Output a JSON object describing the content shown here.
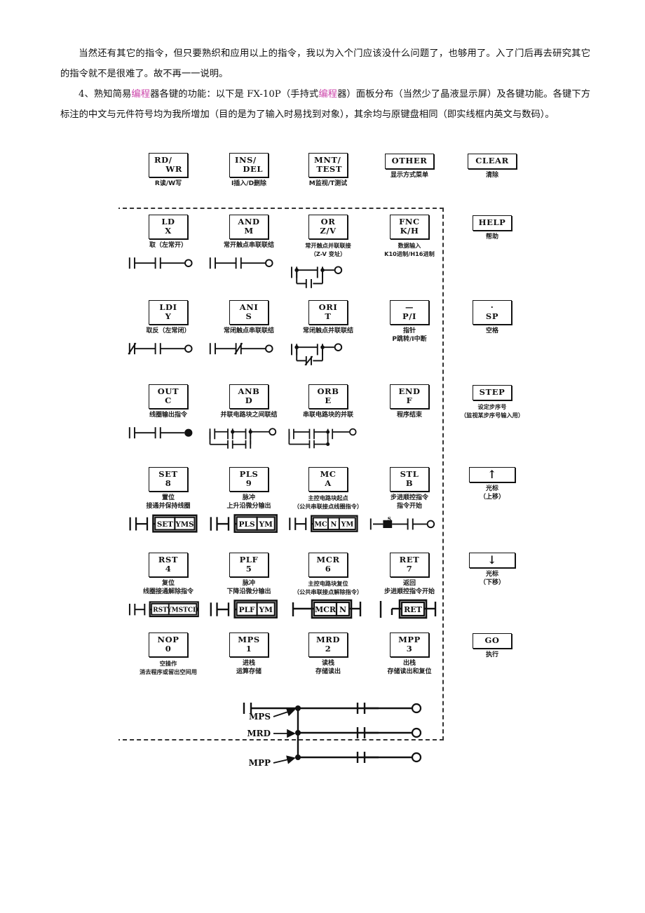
{
  "prose": {
    "p1_a": "当然还有其它的指令，但只要熟织和应用以上的指令，我以为入个门应该没什么问题了，也够用了。入了门后再去研究其它的指令就不是很难了。故不再一一说明。",
    "p2_a": "4、熟知简易",
    "p2_hl1": "编程",
    "p2_b": "器各键的功能：以下是 FX-10P（手持式",
    "p2_hl2": "编程",
    "p2_c": "器）面板分布（当然少了晶液显示屏）及各键功能。各键下方标注的中文与元件符号均为我所增加（目的是为了输入时易找到对象），其余均与原键盘相同（即实线框内英文与数码）。",
    "highlight_color": "#cc44aa"
  },
  "keypad": {
    "keys": [
      {
        "id": "rd-wr",
        "l1": "RD/",
        "l2": "WR",
        "zh": [
          "R读/W写"
        ]
      },
      {
        "id": "ins-del",
        "l1": "INS/",
        "l2": "DEL",
        "zh": [
          "I插入/D删除"
        ]
      },
      {
        "id": "mnt-test",
        "l1": "MNT/",
        "l2": "TEST",
        "zh": [
          "M监视/T测试"
        ]
      },
      {
        "id": "other",
        "l1": "OTHER",
        "l2": "",
        "zh": [
          "显示方式菜单"
        ]
      },
      {
        "id": "clear",
        "l1": "CLEAR",
        "l2": "",
        "zh": [
          "清除"
        ]
      },
      {
        "id": "ld-x",
        "l1": "LD",
        "l2": "X",
        "zh": [
          "取（左常开）"
        ],
        "ladder": "no-contact"
      },
      {
        "id": "and-m",
        "l1": "AND",
        "l2": "M",
        "zh": [
          "常开触点串联联结"
        ],
        "ladder": "and-series"
      },
      {
        "id": "or-zv",
        "l1": "OR",
        "l2": "Z/V",
        "zh": [
          "常开触点并联联接",
          "（Z-V 变址）"
        ],
        "ladder": "or-parallel"
      },
      {
        "id": "fnc-kh",
        "l1": "FNC",
        "l2": "K/H",
        "zh": [
          "数据输入",
          "K10进制/H16进制"
        ]
      },
      {
        "id": "help",
        "l1": "HELP",
        "l2": "",
        "zh": [
          "帮助"
        ]
      },
      {
        "id": "ldi-y",
        "l1": "LDI",
        "l2": "Y",
        "zh": [
          "取反（左常闭）"
        ],
        "ladder": "nc-contact"
      },
      {
        "id": "ani-s",
        "l1": "ANI",
        "l2": "S",
        "zh": [
          "常闭触点串联联结"
        ],
        "ladder": "ani-series"
      },
      {
        "id": "ori-t",
        "l1": "ORI",
        "l2": "T",
        "zh": [
          "常闭触点并联联结"
        ],
        "ladder": "ori-parallel"
      },
      {
        "id": "p-i",
        "l1": "—",
        "l2": "P/I",
        "zh": [
          "指针",
          "P跳转/I中断"
        ]
      },
      {
        "id": "sp",
        "l1": "·",
        "l2": "SP",
        "zh": [
          "空格"
        ]
      },
      {
        "id": "out-c",
        "l1": "OUT",
        "l2": "C",
        "zh": [
          "线圈输出指令"
        ],
        "ladder": "out-coil"
      },
      {
        "id": "anb-d",
        "l1": "ANB",
        "l2": "D",
        "zh": [
          "并联电路块之间联结"
        ],
        "ladder": "anb"
      },
      {
        "id": "orb-e",
        "l1": "ORB",
        "l2": "E",
        "zh": [
          "串联电路块的并联"
        ],
        "ladder": "orb"
      },
      {
        "id": "end-f",
        "l1": "END",
        "l2": "F",
        "zh": [
          "程序结束"
        ]
      },
      {
        "id": "step",
        "l1": "STEP",
        "l2": "",
        "zh": [
          "设定步序号",
          "（监视某步序号输入用）"
        ]
      },
      {
        "id": "set-8",
        "l1": "SET",
        "l2": "8",
        "zh": [
          "置位",
          "接通并保持线圈"
        ],
        "ladder": "box",
        "box": [
          "SET",
          "YMS"
        ]
      },
      {
        "id": "pls-9",
        "l1": "PLS",
        "l2": "9",
        "zh": [
          "脉冲",
          "上升沿微分输出"
        ],
        "ladder": "box",
        "box": [
          "PLS",
          "YM"
        ]
      },
      {
        "id": "mc-a",
        "l1": "MC",
        "l2": "A",
        "zh": [
          "主控电路块起点",
          "（公共串联接点线圈指令）"
        ],
        "ladder": "box3",
        "box": [
          "MC",
          "N",
          "YM"
        ]
      },
      {
        "id": "stl-b",
        "l1": "STL",
        "l2": "B",
        "zh": [
          "步进顺控指令",
          "指令开始"
        ],
        "ladder": "stl"
      },
      {
        "id": "cursor-up",
        "l1": "↑",
        "l2": "",
        "zh": [
          "光标",
          "（上移）"
        ]
      },
      {
        "id": "rst-4",
        "l1": "RST",
        "l2": "4",
        "zh": [
          "复位",
          "线圈接通解除指令"
        ],
        "ladder": "box",
        "box": [
          "RST",
          "YMSTCD"
        ]
      },
      {
        "id": "plf-5",
        "l1": "PLF",
        "l2": "5",
        "zh": [
          "脉冲",
          "下降沿微分输出"
        ],
        "ladder": "box",
        "box": [
          "PLF",
          "YM"
        ]
      },
      {
        "id": "mcr-6",
        "l1": "MCR",
        "l2": "6",
        "zh": [
          "主控电路块复位",
          "（公共串联接点解除指令）"
        ],
        "ladder": "boxmcr",
        "box": [
          "MCR",
          "N"
        ]
      },
      {
        "id": "ret-7",
        "l1": "RET",
        "l2": "7",
        "zh": [
          "返回",
          "步进顺控指令开始"
        ],
        "ladder": "boxret",
        "box": [
          "RET"
        ]
      },
      {
        "id": "cursor-down",
        "l1": "↓",
        "l2": "",
        "zh": [
          "光标",
          "（下移）"
        ]
      },
      {
        "id": "nop-0",
        "l1": "NOP",
        "l2": "0",
        "zh": [
          "空操作",
          "消去程序或留出空间用"
        ]
      },
      {
        "id": "mps-1",
        "l1": "MPS",
        "l2": "1",
        "zh": [
          "进栈",
          "运算存储"
        ]
      },
      {
        "id": "mrd-2",
        "l1": "MRD",
        "l2": "2",
        "zh": [
          "读栈",
          "存储读出"
        ]
      },
      {
        "id": "mpp-3",
        "l1": "MPP",
        "l2": "3",
        "zh": [
          "出栈",
          "存储读出和复位"
        ]
      },
      {
        "id": "go",
        "l1": "GO",
        "l2": "",
        "zh": [
          "执行"
        ]
      }
    ],
    "stack_labels": [
      "MPS",
      "MRD",
      "MPP"
    ]
  }
}
